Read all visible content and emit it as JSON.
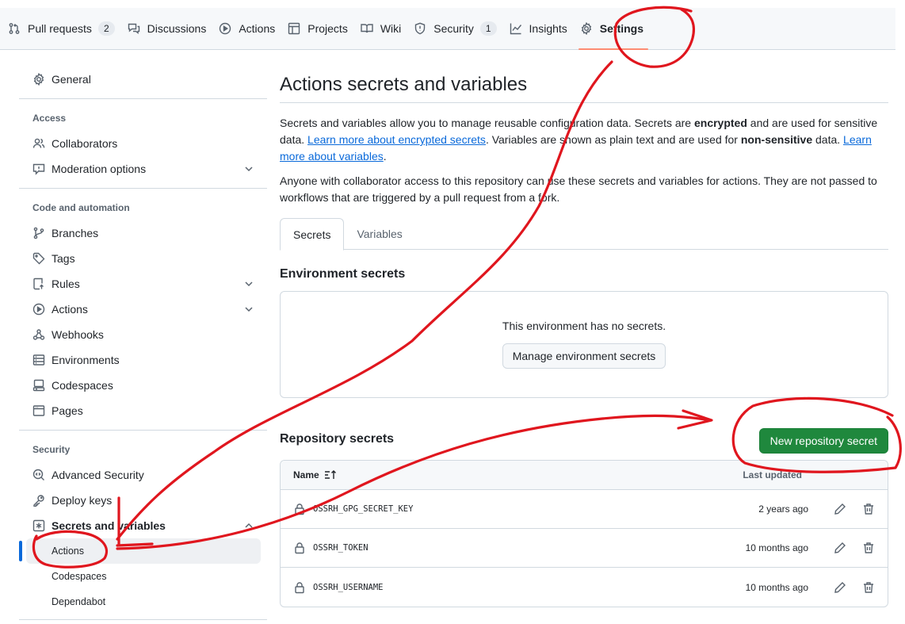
{
  "topnav": {
    "tabs": [
      {
        "label": "Pull requests",
        "count": "2",
        "icon": "git-pull-request-icon"
      },
      {
        "label": "Discussions",
        "count": "",
        "icon": "comment-discussion-icon"
      },
      {
        "label": "Actions",
        "count": "",
        "icon": "play-icon"
      },
      {
        "label": "Projects",
        "count": "",
        "icon": "table-icon"
      },
      {
        "label": "Wiki",
        "count": "",
        "icon": "book-icon"
      },
      {
        "label": "Security",
        "count": "1",
        "icon": "shield-icon"
      },
      {
        "label": "Insights",
        "count": "",
        "icon": "graph-icon"
      },
      {
        "label": "Settings",
        "count": "",
        "icon": "gear-icon",
        "selected": true
      }
    ]
  },
  "sidebar": {
    "general": "General",
    "access_group": "Access",
    "collaborators": "Collaborators",
    "moderation": "Moderation options",
    "code_group": "Code and automation",
    "branches": "Branches",
    "tags": "Tags",
    "rules": "Rules",
    "actions": "Actions",
    "webhooks": "Webhooks",
    "environments": "Environments",
    "codespaces": "Codespaces",
    "pages": "Pages",
    "security_group": "Security",
    "advanced_security": "Advanced Security",
    "deploy_keys": "Deploy keys",
    "secrets_vars": "Secrets and variables",
    "sub_actions": "Actions",
    "sub_codespaces": "Codespaces",
    "sub_dependabot": "Dependabot"
  },
  "main": {
    "title": "Actions secrets and variables",
    "p1_a": "Secrets and variables allow you to manage reusable configuration data. Secrets are ",
    "p1_b": "encrypted",
    "p1_c": " and are used for sensitive data. ",
    "p1_link1": "Learn more about encrypted secrets",
    "p1_d": ". Variables are shown as plain text and are used for ",
    "p1_e": "non-sensitive",
    "p1_f": " data. ",
    "p1_link2": "Learn more about variables",
    "p1_g": ".",
    "p2": "Anyone with collaborator access to this repository can use these secrets and variables for actions. They are not passed to workflows that are triggered by a pull request from a fork.",
    "tab_secrets": "Secrets",
    "tab_variables": "Variables",
    "env_heading": "Environment secrets",
    "env_empty": "This environment has no secrets.",
    "env_button": "Manage environment secrets",
    "repo_heading": "Repository secrets",
    "new_secret_button": "New repository secret",
    "col_name": "Name",
    "col_updated": "Last updated",
    "secrets": [
      {
        "name": "OSSRH_GPG_SECRET_KEY",
        "updated": "2 years ago"
      },
      {
        "name": "OSSRH_TOKEN",
        "updated": "10 months ago"
      },
      {
        "name": "OSSRH_USERNAME",
        "updated": "10 months ago"
      }
    ]
  },
  "colors": {
    "accent_link": "#0969da",
    "primary_button": "#1f883d",
    "annotation": "#e0161e"
  }
}
